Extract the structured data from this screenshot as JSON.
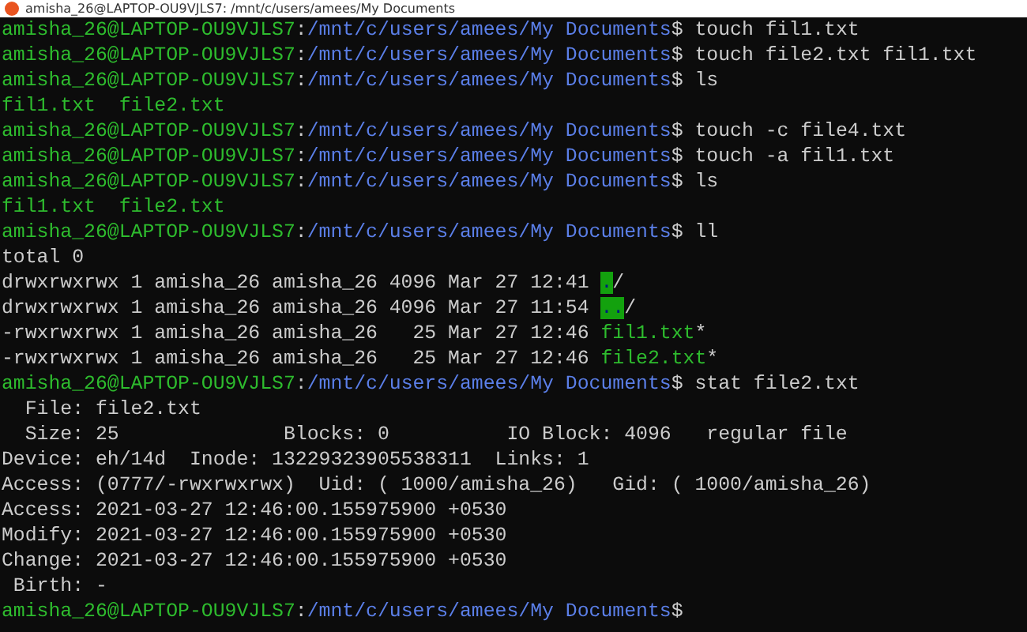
{
  "window": {
    "title": "amisha_26@LAPTOP-OU9VJLS7: /mnt/c/users/amees/My Documents"
  },
  "terminal": {
    "lines": [
      [
        {
          "kind": "user",
          "text": "amisha_26@LAPTOP-OU9VJLS7"
        },
        {
          "kind": "plain",
          "text": ":"
        },
        {
          "kind": "path",
          "text": "/mnt/c/users/amees/My Documents"
        },
        {
          "kind": "plain",
          "text": "$ touch fil1.txt"
        }
      ],
      [
        {
          "kind": "user",
          "text": "amisha_26@LAPTOP-OU9VJLS7"
        },
        {
          "kind": "plain",
          "text": ":"
        },
        {
          "kind": "path",
          "text": "/mnt/c/users/amees/My Documents"
        },
        {
          "kind": "plain",
          "text": "$ touch file2.txt fil1.txt"
        }
      ],
      [
        {
          "kind": "user",
          "text": "amisha_26@LAPTOP-OU9VJLS7"
        },
        {
          "kind": "plain",
          "text": ":"
        },
        {
          "kind": "path",
          "text": "/mnt/c/users/amees/My Documents"
        },
        {
          "kind": "plain",
          "text": "$ ls"
        }
      ],
      [
        {
          "kind": "exec",
          "text": "fil1.txt"
        },
        {
          "kind": "exec",
          "text": "file2.txt"
        }
      ],
      [
        {
          "kind": "user",
          "text": "amisha_26@LAPTOP-OU9VJLS7"
        },
        {
          "kind": "plain",
          "text": ":"
        },
        {
          "kind": "path",
          "text": "/mnt/c/users/amees/My Documents"
        },
        {
          "kind": "plain",
          "text": "$ touch -c file4.txt"
        }
      ],
      [
        {
          "kind": "user",
          "text": "amisha_26@LAPTOP-OU9VJLS7"
        },
        {
          "kind": "plain",
          "text": ":"
        },
        {
          "kind": "path",
          "text": "/mnt/c/users/amees/My Documents"
        },
        {
          "kind": "plain",
          "text": "$ touch -a fil1.txt"
        }
      ],
      [
        {
          "kind": "user",
          "text": "amisha_26@LAPTOP-OU9VJLS7"
        },
        {
          "kind": "plain",
          "text": ":"
        },
        {
          "kind": "path",
          "text": "/mnt/c/users/amees/My Documents"
        },
        {
          "kind": "plain",
          "text": "$ ls"
        }
      ],
      [
        {
          "kind": "exec",
          "text": "fil1.txt"
        },
        {
          "kind": "exec",
          "text": "file2.txt"
        }
      ],
      [
        {
          "kind": "user",
          "text": "amisha_26@LAPTOP-OU9VJLS7"
        },
        {
          "kind": "plain",
          "text": ":"
        },
        {
          "kind": "path",
          "text": "/mnt/c/users/amees/My Documents"
        },
        {
          "kind": "plain",
          "text": "$ ll"
        }
      ],
      [
        {
          "kind": "plain",
          "text": "total 0"
        }
      ],
      [
        {
          "kind": "plain",
          "text": "drwxrwxrwx 1 amisha_26 amisha_26 4096 Mar 27 12:41 "
        },
        {
          "kind": "dir",
          "text": "."
        },
        {
          "kind": "plain",
          "text": "/"
        }
      ],
      [
        {
          "kind": "plain",
          "text": "drwxrwxrwx 1 amisha_26 amisha_26 4096 Mar 27 11:54 "
        },
        {
          "kind": "dir",
          "text": ".."
        },
        {
          "kind": "plain",
          "text": "/"
        }
      ],
      [
        {
          "kind": "plain",
          "text": "-rwxrwxrwx 1 amisha_26 amisha_26   25 Mar 27 12:46 "
        },
        {
          "kind": "exec",
          "text": "fil1.txt"
        },
        {
          "kind": "plain",
          "text": "*"
        }
      ],
      [
        {
          "kind": "plain",
          "text": "-rwxrwxrwx 1 amisha_26 amisha_26   25 Mar 27 12:46 "
        },
        {
          "kind": "exec",
          "text": "file2.txt"
        },
        {
          "kind": "plain",
          "text": "*"
        }
      ],
      [
        {
          "kind": "user",
          "text": "amisha_26@LAPTOP-OU9VJLS7"
        },
        {
          "kind": "plain",
          "text": ":"
        },
        {
          "kind": "path",
          "text": "/mnt/c/users/amees/My Documents"
        },
        {
          "kind": "plain",
          "text": "$ stat file2.txt"
        }
      ],
      [
        {
          "kind": "plain",
          "text": "  File: file2.txt"
        }
      ],
      [
        {
          "kind": "plain",
          "text": "  Size: 25              Blocks: 0          IO Block: 4096   regular file"
        }
      ],
      [
        {
          "kind": "plain",
          "text": "Device: eh/14d  Inode: 13229323905538311  Links: 1"
        }
      ],
      [
        {
          "kind": "plain",
          "text": "Access: (0777/-rwxrwxrwx)  Uid: ( 1000/amisha_26)   Gid: ( 1000/amisha_26)"
        }
      ],
      [
        {
          "kind": "plain",
          "text": "Access: 2021-03-27 12:46:00.155975900 +0530"
        }
      ],
      [
        {
          "kind": "plain",
          "text": "Modify: 2021-03-27 12:46:00.155975900 +0530"
        }
      ],
      [
        {
          "kind": "plain",
          "text": "Change: 2021-03-27 12:46:00.155975900 +0530"
        }
      ],
      [
        {
          "kind": "plain",
          "text": " Birth: -"
        }
      ],
      [
        {
          "kind": "user",
          "text": "amisha_26@LAPTOP-OU9VJLS7"
        },
        {
          "kind": "plain",
          "text": ":"
        },
        {
          "kind": "path",
          "text": "/mnt/c/users/amees/My Documents"
        },
        {
          "kind": "plain",
          "text": "$"
        }
      ]
    ]
  }
}
